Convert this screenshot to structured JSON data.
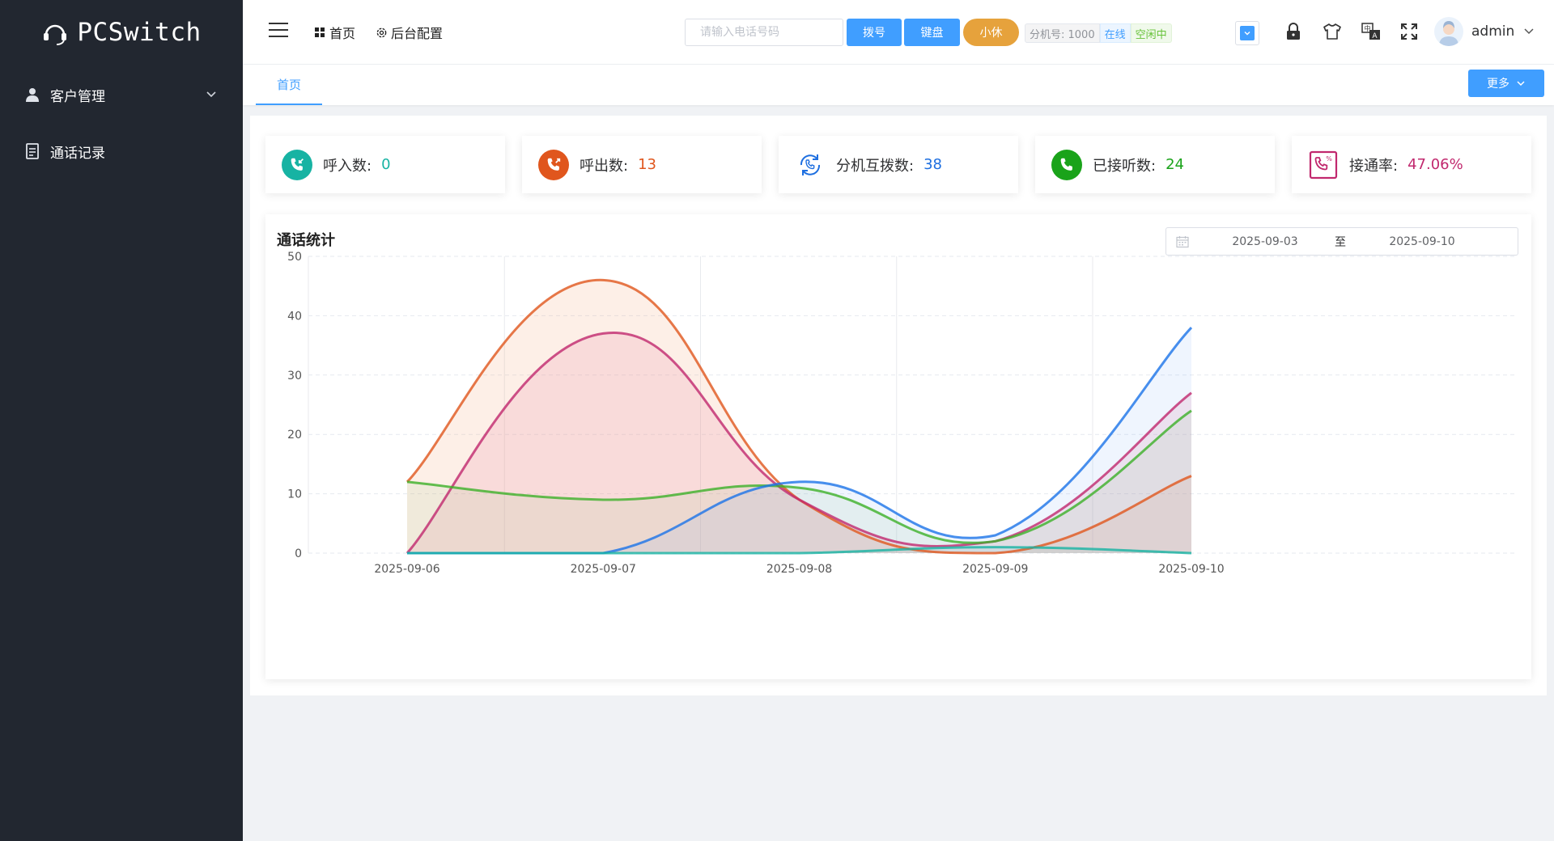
{
  "sidebar": {
    "logo_text": "PCSwitch",
    "items": [
      {
        "label": "客户管理",
        "icon": "user-icon",
        "has_submenu": true
      },
      {
        "label": "通话记录",
        "icon": "document-icon",
        "has_submenu": false
      }
    ]
  },
  "header": {
    "nav_home": "首页",
    "nav_config": "后台配置",
    "phone_placeholder": "请输入电话号码",
    "dial_button": "拨号",
    "keyboard_button": "键盘",
    "rest_button": "小休",
    "extension_label": "分机号: 1000",
    "status_online": "在线",
    "status_idle": "空闲中",
    "username": "admin"
  },
  "tabs": {
    "items": [
      {
        "label": "首页",
        "active": true
      }
    ],
    "more_button": "更多"
  },
  "stats": [
    {
      "label": "呼入数:",
      "value": "0",
      "color": "#17b3a3",
      "icon": "incoming-call-icon"
    },
    {
      "label": "呼出数:",
      "value": "13",
      "color": "#e0561d",
      "icon": "outgoing-call-icon"
    },
    {
      "label": "分机互拨数:",
      "value": "38",
      "color": "#1e6fe0",
      "icon": "call-transfer-icon"
    },
    {
      "label": "已接听数:",
      "value": "24",
      "color": "#1aa31a",
      "icon": "answered-call-icon"
    },
    {
      "label": "接通率:",
      "value": "47.06%",
      "color": "#c1286e",
      "icon": "connection-rate-icon"
    }
  ],
  "chart_panel": {
    "title": "通话统计",
    "date_start": "2025-09-03",
    "date_separator": "至",
    "date_end": "2025-09-10"
  },
  "chart_data": {
    "type": "area",
    "x": [
      "2025-09-06",
      "2025-09-07",
      "2025-09-08",
      "2025-09-09",
      "2025-09-10"
    ],
    "ylim": [
      0,
      50
    ],
    "yticks": [
      0,
      10,
      20,
      30,
      40,
      50
    ],
    "grid": true,
    "smooth": true,
    "series": [
      {
        "values": [
          12,
          46,
          9,
          0,
          13
        ],
        "color": "#e0561d",
        "fill": "rgba(244,164,120,0.18)"
      },
      {
        "values": [
          0,
          37,
          9,
          2,
          27
        ],
        "color": "#c1286e",
        "fill": "rgba(232,120,150,0.16)"
      },
      {
        "values": [
          12,
          9,
          11,
          2,
          24
        ],
        "color": "#3cb028",
        "fill": "rgba(150,200,130,0.12)"
      },
      {
        "values": [
          0,
          0,
          12,
          3,
          38
        ],
        "color": "#1a73e8",
        "fill": "rgba(120,170,245,0.12)"
      },
      {
        "values": [
          0,
          0,
          0,
          1,
          0
        ],
        "color": "#17b3a3",
        "fill": "rgba(60,190,180,0.08)"
      }
    ]
  }
}
